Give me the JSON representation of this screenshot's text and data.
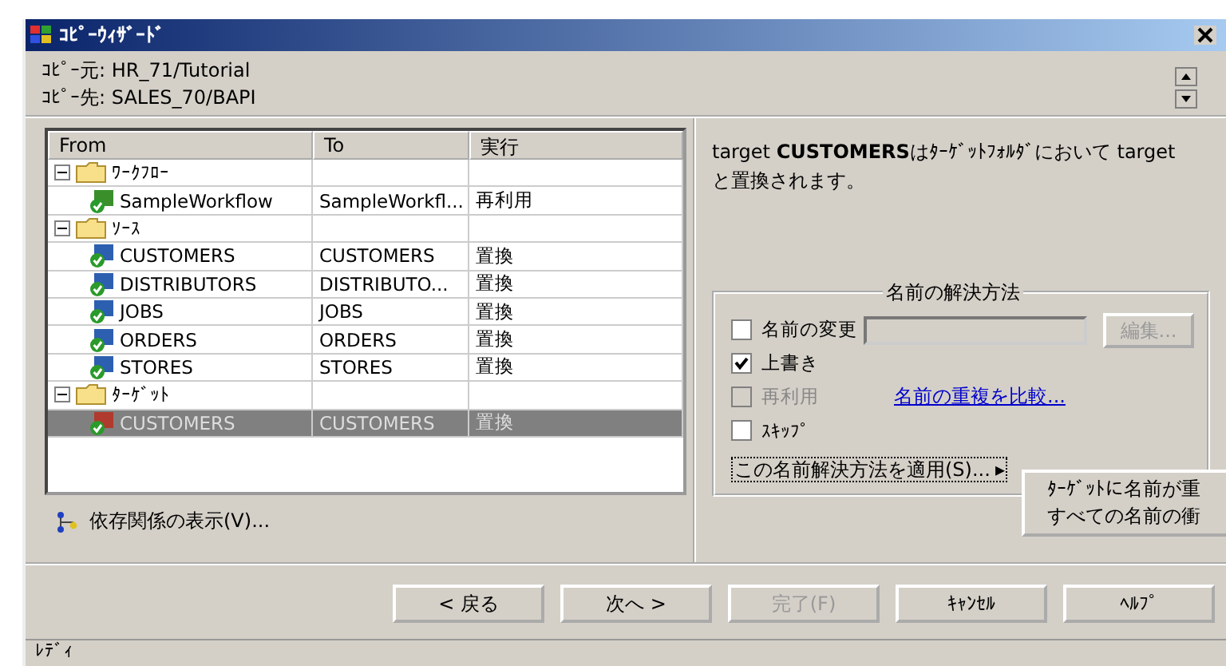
{
  "window": {
    "title": "ｺﾋﾟｰｳｨｻﾞｰﾄﾞ"
  },
  "header": {
    "source": "ｺﾋﾟｰ元: HR_71/Tutorial",
    "target": "ｺﾋﾟｰ先: SALES_70/BAPI"
  },
  "tree": {
    "columns": [
      "From",
      "To",
      "実行"
    ],
    "items": [
      {
        "kind": "folder",
        "label": "ﾜｰｸﾌﾛｰ",
        "expanded": true,
        "children": [
          {
            "kind": "workflow",
            "label": "SampleWorkflow",
            "to": "SampleWorkfl...",
            "action": "再利用",
            "selected": false
          }
        ]
      },
      {
        "kind": "folder",
        "label": "ｿｰｽ",
        "expanded": true,
        "children": [
          {
            "kind": "source",
            "label": "CUSTOMERS",
            "to": "CUSTOMERS",
            "action": "置換",
            "selected": false
          },
          {
            "kind": "source",
            "label": "DISTRIBUTORS",
            "to": "DISTRIBUTO...",
            "action": "置換",
            "selected": false
          },
          {
            "kind": "source",
            "label": "JOBS",
            "to": "JOBS",
            "action": "置換",
            "selected": false
          },
          {
            "kind": "source",
            "label": "ORDERS",
            "to": "ORDERS",
            "action": "置換",
            "selected": false
          },
          {
            "kind": "source",
            "label": "STORES",
            "to": "STORES",
            "action": "置換",
            "selected": false
          }
        ]
      },
      {
        "kind": "folder",
        "label": "ﾀｰｹﾞｯﾄ",
        "expanded": true,
        "children": [
          {
            "kind": "target",
            "label": "CUSTOMERS",
            "to": "CUSTOMERS",
            "action": "置換",
            "selected": true
          }
        ]
      }
    ]
  },
  "dependencies_link": "依存関係の表示(V)...",
  "description": "target **CUSTOMERS**はﾀｰｹﾞｯﾄﾌｫﾙﾀﾞにおいて targetと置換されます。",
  "resolution": {
    "title": "名前の解決方法",
    "options": [
      {
        "label": "名前の変更",
        "checked": false,
        "disabled": false
      },
      {
        "label": "上書き",
        "checked": true,
        "disabled": false
      },
      {
        "label": "再利用",
        "checked": false,
        "disabled": true
      },
      {
        "label": "ｽｷｯﾌﾟ",
        "checked": false,
        "disabled": false
      }
    ],
    "rename_field": {
      "disabled": true
    },
    "edit_button": {
      "label": "編集...",
      "disabled": true
    },
    "compare_link": "名前の重複を比較...",
    "apply_button": "この名前解決方法を適用(S)...",
    "apply_arrow": "▸"
  },
  "popup_menu": [
    "ﾀｰｹﾞｯﾄに名前が重",
    "すべての名前の衝"
  ],
  "buttons": [
    {
      "label": "< 戻る",
      "disabled": false
    },
    {
      "label": "次へ >",
      "disabled": false
    },
    {
      "label": "完了(F)",
      "disabled": true
    },
    {
      "label": "ｷｬﾝｾﾙ",
      "disabled": false
    },
    {
      "label": "ﾍﾙﾌﾟ",
      "disabled": false
    }
  ],
  "status_bar": "ﾚﾃﾞｨ"
}
